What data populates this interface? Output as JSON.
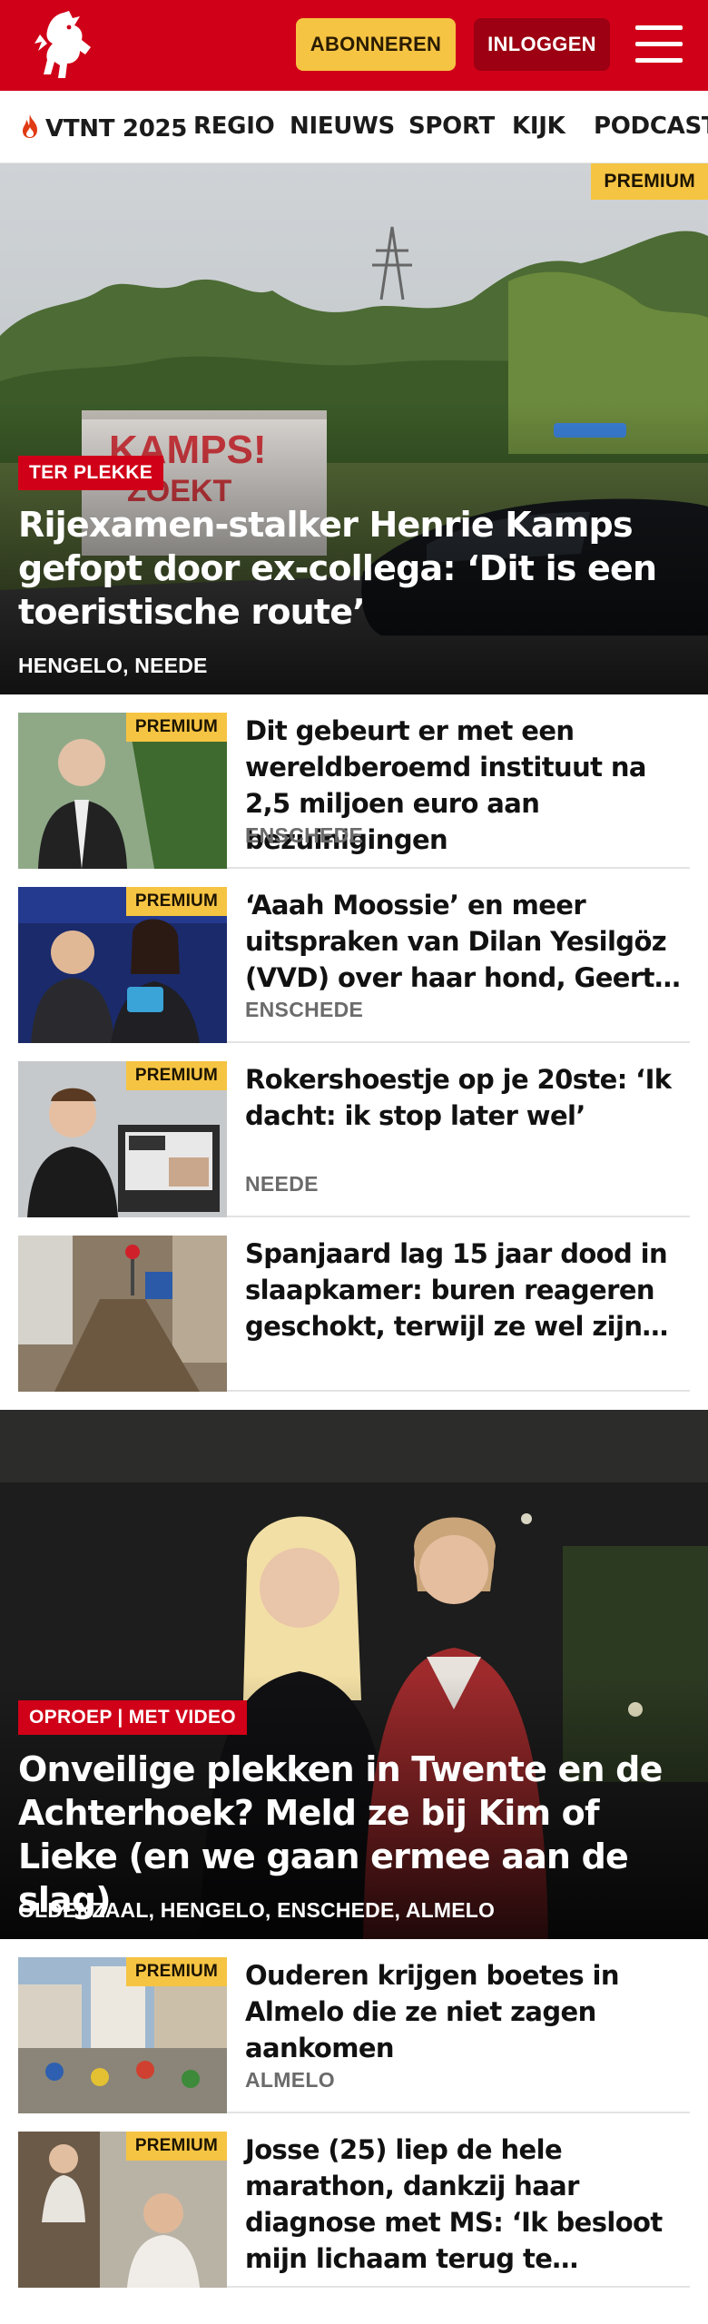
{
  "header": {
    "subscribe_label": "ABONNEREN",
    "login_label": "INLOGGEN",
    "brand_color": "#d00018",
    "subscribe_color": "#f6c443"
  },
  "nav": {
    "items": [
      {
        "label": "VTNT 2025",
        "icon": "flame-icon"
      },
      {
        "label": "REGIO"
      },
      {
        "label": "NIEUWS"
      },
      {
        "label": "SPORT"
      },
      {
        "label": "KIJK"
      },
      {
        "label": "PODCAST"
      }
    ]
  },
  "hero1": {
    "premium_label": "PREMIUM",
    "tag": "TER PLEKKE",
    "title": "Rijexamen-stalker Henrie Kamps gefopt door ex-collega: ‘Dit is een toeristische route’",
    "location": "HENGELO, NEEDE"
  },
  "articles1": [
    {
      "premium": "PREMIUM",
      "title": "Dit gebeurt er met een wereldbe­roemd instituut na 2,5 miljoen euro aan bezuinigingen",
      "location": "ENSCHEDE"
    },
    {
      "premium": "PREMIUM",
      "title": "‘Aaah Moossie’ en meer uitspraken van Dilan Yesilgöz (VVD) over haar hond, Geert…",
      "location": "ENSCHEDE"
    },
    {
      "premium": "PREMIUM",
      "title": "Rokershoestje op je 20ste: ‘Ik dacht: ik stop later wel’",
      "location": "NEEDE"
    },
    {
      "premium": "",
      "title": "Spanjaard lag 15 jaar dood in slaapkamer: buren reageren geschokt, terwijl ze wel zijn…",
      "location": ""
    }
  ],
  "hero2": {
    "tag": "OPROEP | MET VIDEO",
    "title": "Onveilige plekken in Twente en de Achterhoek? Meld ze bij Kim of Lieke (en we gaan ermee aan de slag)",
    "location": "OLDENZAAL, HENGELO, ENSCHEDE, ALMELO"
  },
  "articles2": [
    {
      "premium": "PREMIUM",
      "title": "Ouderen krijgen boetes in Almelo die ze niet zagen aankomen",
      "location": "ALMELO"
    },
    {
      "premium": "PREMIUM",
      "title": "Josse (25) liep de hele marathon, dankzij haar diagnose met MS: ‘Ik besloot mijn lichaam terug te…",
      "location": ""
    }
  ]
}
